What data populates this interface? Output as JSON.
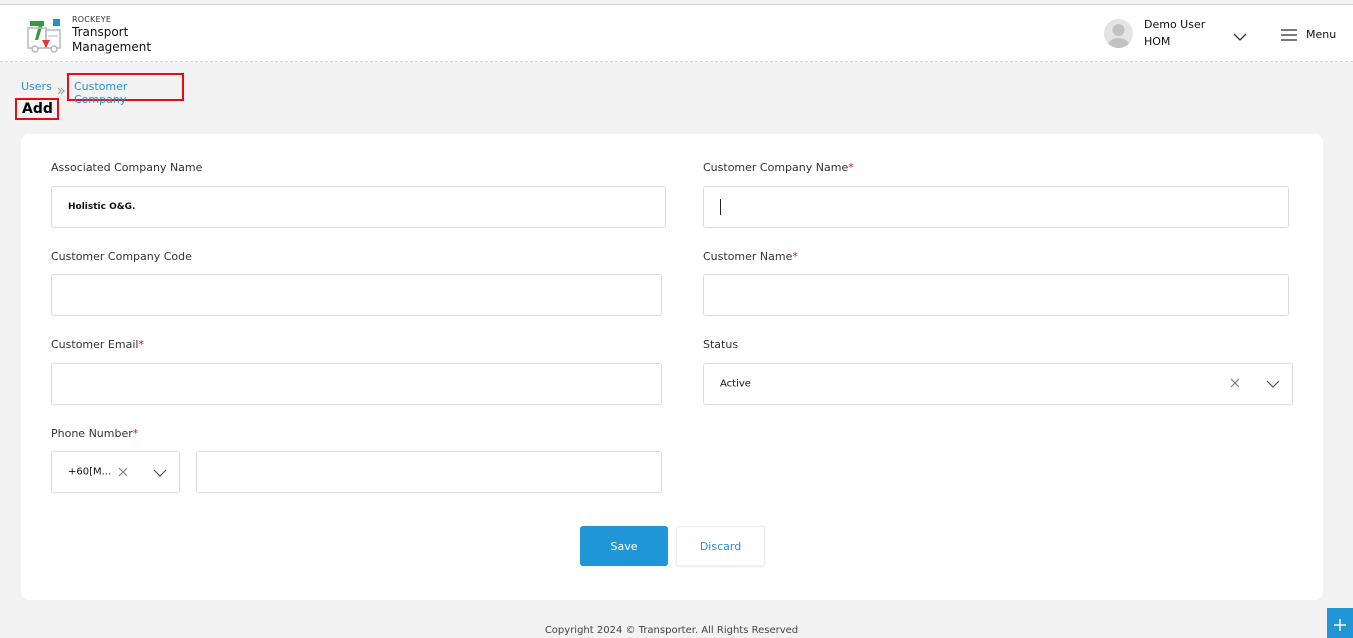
{
  "header": {
    "brand_small": "ROCKEYE",
    "brand_line1": "Transport",
    "brand_line2": "Management",
    "user_name": "Demo User",
    "user_role": "HOM",
    "menu_label": "Menu"
  },
  "breadcrumb": {
    "users": "Users",
    "current": "Customer Company"
  },
  "page_title": "Add",
  "form": {
    "associated_company_label": "Associated Company Name",
    "associated_company_value": "Holistic O&G.",
    "customer_company_name_label": "Customer Company Name",
    "customer_company_code_label": "Customer Company Code",
    "customer_name_label": "Customer Name",
    "customer_email_label": "Customer Email",
    "status_label": "Status",
    "status_value": "Active",
    "phone_label": "Phone Number",
    "phone_code_value": "+60[M...",
    "required_mark": "*"
  },
  "actions": {
    "save": "Save",
    "discard": "Discard"
  },
  "footer": {
    "copyright": "Copyright 2024 © Transporter. All Rights Reserved"
  },
  "colors": {
    "accent": "#2196d6",
    "highlight_border": "#e01010"
  }
}
